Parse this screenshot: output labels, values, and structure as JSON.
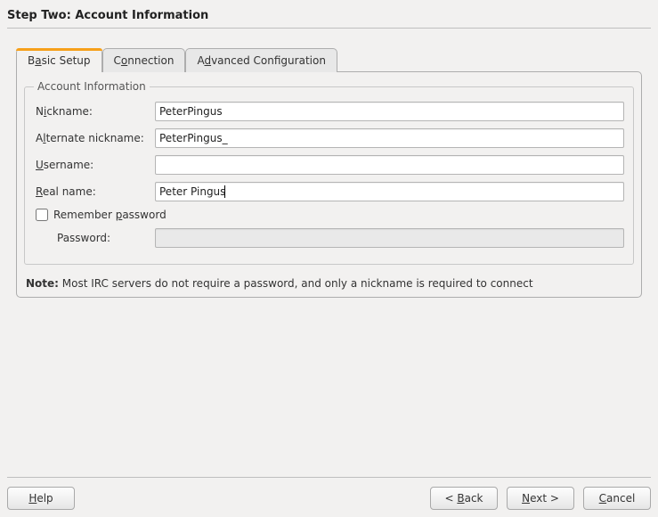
{
  "heading": "Step Two: Account Information",
  "tabs": {
    "basic": {
      "pre": "B",
      "mn": "a",
      "post": "sic Setup"
    },
    "conn": {
      "pre": "C",
      "mn": "o",
      "post": "nnection"
    },
    "adv": {
      "pre": "A",
      "mn": "d",
      "post": "vanced Configuration"
    }
  },
  "group": {
    "title": "Account Information"
  },
  "fields": {
    "nickname": {
      "label_pre": "N",
      "label_mn": "i",
      "label_post": "ckname:",
      "value": "PeterPingus"
    },
    "altnick": {
      "label_pre": "A",
      "label_mn": "l",
      "label_post": "ternate nickname:",
      "value": "PeterPingus_"
    },
    "username": {
      "label_pre": "",
      "label_mn": "U",
      "label_post": "sername:",
      "value": ""
    },
    "realname": {
      "label_pre": "",
      "label_mn": "R",
      "label_post": "eal name:",
      "value": "Peter Pingus"
    },
    "remember": {
      "label_pre": "Remember ",
      "label_mn": "p",
      "label_post": "assword",
      "checked": false
    },
    "password": {
      "label": "Password:",
      "value": ""
    }
  },
  "note": {
    "label": "Note:",
    "text": " Most IRC servers do not require a password, and only a nickname is required to connect"
  },
  "buttons": {
    "help": {
      "pre": "",
      "mn": "H",
      "post": "elp"
    },
    "back": {
      "pre": "< ",
      "mn": "B",
      "post": "ack"
    },
    "next": {
      "pre": "",
      "mn": "N",
      "post": "ext >"
    },
    "cancel": {
      "pre": "",
      "mn": "C",
      "post": "ancel"
    }
  }
}
